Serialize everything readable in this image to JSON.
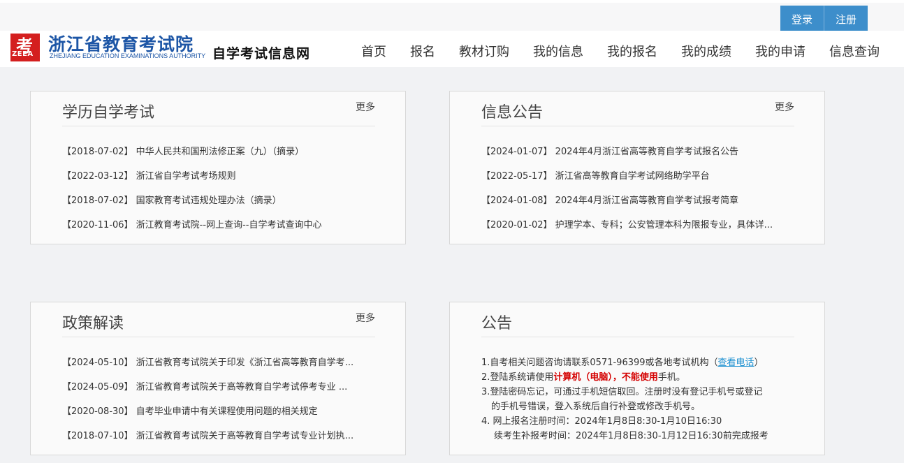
{
  "auth": {
    "login": "登录",
    "register": "注册"
  },
  "brand": {
    "logo_glyph": "考",
    "logo_abbr": "ZEEA",
    "org_cn": "浙江省教育考试院",
    "org_en": "ZHEJIANG EDUCATION EXAMINATIONS AUTHORITY",
    "site_cn": "自学考试信息网"
  },
  "nav": [
    "首页",
    "报名",
    "教材订购",
    "我的信息",
    "我的报名",
    "我的成绩",
    "我的申请",
    "信息查询"
  ],
  "cards": {
    "xueli": {
      "title": "学历自学考试",
      "more": "更多",
      "items": [
        "【2018-07-02】 中华人民共和国刑法修正案（九）（摘录）",
        "【2022-03-12】 浙江省自学考试考场规则",
        "【2018-07-02】 国家教育考试违规处理办法（摘录）",
        "【2020-11-06】 浙江教育考试院--网上查询--自学考试查询中心"
      ]
    },
    "xinxi": {
      "title": "信息公告",
      "more": "更多",
      "items": [
        "【2024-01-07】 2024年4月浙江省高等教育自学考试报名公告",
        "【2022-05-17】 浙江省高等教育自学考试网络助学平台",
        "【2024-01-08】 2024年4月浙江省高等教育自学考试报考简章",
        "【2020-01-02】 护理学本、专科；公安管理本科为限报专业，具体详..."
      ]
    },
    "zhengce": {
      "title": "政策解读",
      "more": "更多",
      "items": [
        "【2024-05-10】 浙江省教育考试院关于印发《浙江省高等教育自学考...",
        "【2024-05-09】 浙江省教育考试院关于高等教育自学考试停考专业 ...",
        "【2020-08-30】 自考毕业申请中有关课程使用问题的相关规定",
        "【2018-07-10】 浙江省教育考试院关于高等教育自学考试专业计划执..."
      ]
    },
    "gonggao": {
      "title": "公告",
      "n1_pre": "1.自考相关问题咨询请联系0571-96399或各地考试机构（",
      "n1_link": "查看电话",
      "n1_post": "）",
      "n2_pre": "2.登陆系统请使用",
      "n2_red1": "计算机（电脑），不能使用",
      "n2_post": "手机。",
      "n3_line1": "3.登陆密码忘记，可通过手机短信取回。注册时没有登记手机号或登记",
      "n3_line2": "的手机号错误，登入系统后自行补登或修改手机号。",
      "n4_line1": "4. 网上报名注册时间：2024年1月8日8:30-1月10日16:30",
      "n4_line2": "续考生补报考时间：2024年1月8日8:30-1月12日16:30前完成报考"
    }
  },
  "colors": {
    "accent": "#3d8ecb",
    "brand_blue": "#1d56a6",
    "logo_red": "#d41f1f",
    "notice_red": "#d40000",
    "link": "#1a8fd0"
  }
}
